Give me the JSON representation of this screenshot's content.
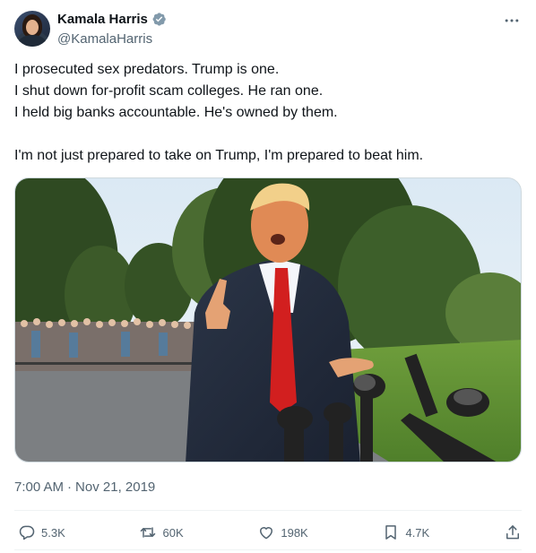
{
  "author": {
    "display_name": "Kamala Harris",
    "handle": "@KamalaHarris",
    "verified": true,
    "avatar_icon": "profile-photo",
    "verified_color": "#829aab"
  },
  "tweet": {
    "lines": [
      "I prosecuted sex predators. Trump is one.",
      "I shut down for-profit scam colleges. He ran one.",
      "I held big banks accountable. He's owned by them.",
      "I'm not just prepared to take on Trump, I'm prepared to beat him."
    ],
    "time": "7:00 AM",
    "separator": "·",
    "date": "Nov 21, 2019"
  },
  "actions": {
    "replies": "5.3K",
    "reposts": "60K",
    "likes": "198K",
    "bookmarks": "4.7K",
    "icons": [
      "reply-icon",
      "repost-icon",
      "like-icon",
      "bookmark-icon",
      "share-icon"
    ]
  },
  "colors": {
    "text": "#0f1419",
    "muted": "#536471",
    "border": "#cfd9de"
  }
}
